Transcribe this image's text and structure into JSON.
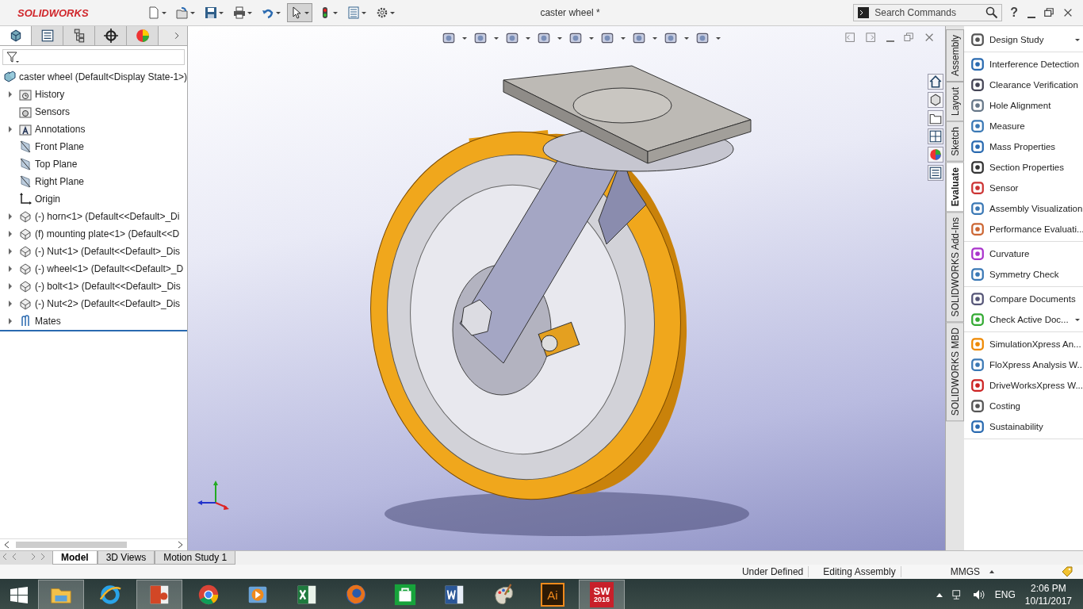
{
  "title_bar": {
    "logo": "SOLIDWORKS",
    "title": "caster wheel *",
    "search": {
      "placeholder": "Search Commands"
    },
    "help": "?"
  },
  "toolbar": [
    {
      "kind": "new",
      "pressed": false
    },
    {
      "kind": "open",
      "pressed": false
    },
    {
      "kind": "save",
      "pressed": false
    },
    {
      "kind": "print",
      "pressed": false
    },
    {
      "kind": "undo",
      "pressed": false
    },
    {
      "kind": "select",
      "pressed": true
    },
    {
      "kind": "rebuild",
      "pressed": false
    },
    {
      "kind": "file-properties",
      "pressed": false
    },
    {
      "kind": "options",
      "pressed": false
    }
  ],
  "panel_tabs": [
    {
      "kind": "feature-manager",
      "selected": true
    },
    {
      "kind": "property-manager",
      "selected": false
    },
    {
      "kind": "configuration-manager",
      "selected": false
    },
    {
      "kind": "dimxpert",
      "selected": false
    },
    {
      "kind": "display-manager",
      "selected": false
    }
  ],
  "tree": [
    {
      "label": "caster wheel  (Default<Display State-1>)",
      "kind": "assembly",
      "children": [
        {
          "label": "History",
          "kind": "history",
          "expandable": true
        },
        {
          "label": "Sensors",
          "kind": "sensors",
          "expandable": false
        },
        {
          "label": "Annotations",
          "kind": "annotations",
          "expandable": true
        },
        {
          "label": "Front Plane",
          "kind": "plane",
          "expandable": false
        },
        {
          "label": "Top Plane",
          "kind": "plane",
          "expandable": false
        },
        {
          "label": "Right Plane",
          "kind": "plane",
          "expandable": false
        },
        {
          "label": "Origin",
          "kind": "origin",
          "expandable": false
        },
        {
          "label": "(-) horn<1> (Default<<Default>_Di",
          "kind": "part",
          "expandable": true
        },
        {
          "label": "(f) mounting plate<1> (Default<<D",
          "kind": "part",
          "expandable": true
        },
        {
          "label": "(-) Nut<1> (Default<<Default>_Dis",
          "kind": "part",
          "expandable": true
        },
        {
          "label": "(-) wheel<1> (Default<<Default>_D",
          "kind": "part",
          "expandable": true
        },
        {
          "label": "(-) bolt<1> (Default<<Default>_Dis",
          "kind": "part",
          "expandable": true
        },
        {
          "label": "(-) Nut<2> (Default<<Default>_Dis",
          "kind": "part",
          "expandable": true
        },
        {
          "label": "Mates",
          "kind": "mates",
          "expandable": true
        }
      ]
    }
  ],
  "side_tabs": [
    {
      "label": "Assembly",
      "selected": false
    },
    {
      "label": "Layout",
      "selected": false
    },
    {
      "label": "Sketch",
      "selected": false
    },
    {
      "label": "Evaluate",
      "selected": true
    },
    {
      "label": "SOLIDWORKS Add-Ins",
      "selected": false
    },
    {
      "label": "SOLIDWORKS MBD",
      "selected": false
    }
  ],
  "command_groups": [
    [
      {
        "label": "Design Study",
        "kind": "design-study",
        "has_menu": true
      }
    ],
    [
      {
        "label": "Interference Detection",
        "kind": "interference",
        "has_menu": false
      },
      {
        "label": "Clearance Verification",
        "kind": "clearance",
        "has_menu": false
      },
      {
        "label": "Hole Alignment",
        "kind": "hole",
        "has_menu": false
      },
      {
        "label": "Measure",
        "kind": "measure",
        "has_menu": false
      },
      {
        "label": "Mass Properties",
        "kind": "mass",
        "has_menu": false
      },
      {
        "label": "Section Properties",
        "kind": "section",
        "has_menu": false
      },
      {
        "label": "Sensor",
        "kind": "sensor",
        "has_menu": false
      },
      {
        "label": "Assembly Visualization",
        "kind": "visualization",
        "has_menu": false
      },
      {
        "label": "Performance Evaluati...",
        "kind": "performance",
        "has_menu": false
      }
    ],
    [
      {
        "label": "Curvature",
        "kind": "curvature",
        "has_menu": false
      },
      {
        "label": "Symmetry Check",
        "kind": "symmetry",
        "has_menu": false
      }
    ],
    [
      {
        "label": "Compare Documents",
        "kind": "compare",
        "has_menu": false
      },
      {
        "label": "Check Active Doc...",
        "kind": "check",
        "has_menu": true
      }
    ],
    [
      {
        "label": "SimulationXpress An...",
        "kind": "simulation",
        "has_menu": false
      },
      {
        "label": "FloXpress Analysis W...",
        "kind": "flow",
        "has_menu": false
      },
      {
        "label": "DriveWorksXpress W...",
        "kind": "driveworks",
        "has_menu": false
      },
      {
        "label": "Costing",
        "kind": "costing",
        "has_menu": false
      },
      {
        "label": "Sustainability",
        "kind": "sustainability",
        "has_menu": false
      }
    ]
  ],
  "bottom_tabs": [
    {
      "label": "Model",
      "selected": true
    },
    {
      "label": "3D Views",
      "selected": false
    },
    {
      "label": "Motion Study 1",
      "selected": false
    }
  ],
  "status_bar": {
    "items": [
      "Under Defined",
      "Editing Assembly"
    ],
    "units": "MMGS"
  },
  "taskbar": {
    "apps": [
      {
        "kind": "explorer",
        "active": true
      },
      {
        "kind": "ie",
        "active": false
      },
      {
        "kind": "powerpoint",
        "active": true
      },
      {
        "kind": "chrome",
        "active": false
      },
      {
        "kind": "media",
        "active": false
      },
      {
        "kind": "excel",
        "active": false
      },
      {
        "kind": "firefox",
        "active": false
      },
      {
        "kind": "store",
        "active": false
      },
      {
        "kind": "word",
        "active": false
      },
      {
        "kind": "paint",
        "active": false
      },
      {
        "kind": "illustrator",
        "active": false,
        "text": "Ai"
      },
      {
        "kind": "solidworks",
        "active": true,
        "text": "SW",
        "subtext": "2016"
      }
    ],
    "language": "ENG",
    "time": "2:06 PM",
    "date": "10/11/2017"
  }
}
